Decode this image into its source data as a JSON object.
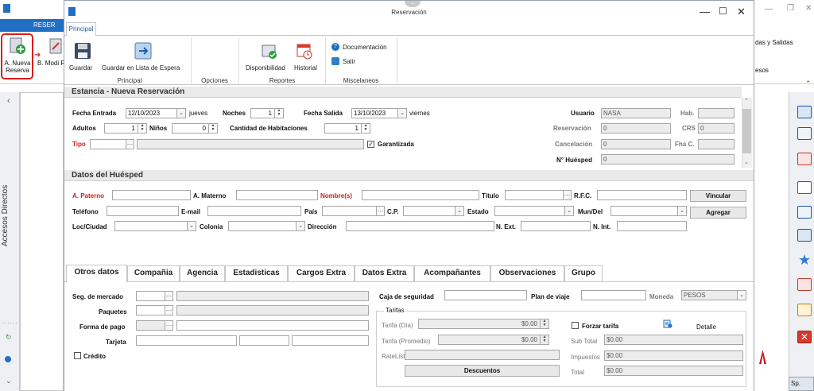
{
  "background_app": {
    "tab_label": "RESER",
    "new_reservation": "A. Nueva Reserva",
    "modify_reservation": "B. Modi Reser",
    "right_partial_1": "das y Salidas",
    "right_partial_2": "esos",
    "left_panel_label": "Accesos Directos",
    "right_bottom_label": "Sp."
  },
  "window": {
    "title": "Reservación",
    "tab": "Principal"
  },
  "ribbon": {
    "guardar": "Guardar",
    "guardar_lista": "Guardar en Lista de Espera",
    "grupo_principal": "Principal",
    "grupo_opciones": "Opciones",
    "disponibilidad": "Disponibilidad",
    "historial": "Historial",
    "grupo_reportes": "Reportes",
    "documentacion": "Documentación",
    "salir": "Salir",
    "grupo_miscelaneos": "Miscelaneos"
  },
  "estancia": {
    "title": "Estancia - Nueva Reservación",
    "fecha_entrada_label": "Fecha Entrada",
    "fecha_entrada": "12/10/2023",
    "fecha_entrada_dia": "jueves",
    "noches_label": "Noches",
    "noches": "1",
    "fecha_salida_label": "Fecha Salida",
    "fecha_salida": "13/10/2023",
    "fecha_salida_dia": "viernes",
    "adultos_label": "Adultos",
    "adultos": "1",
    "ninos_label": "Niños",
    "ninos": "0",
    "cant_hab_label": "Cantidad de Habitaciones",
    "cant_hab": "1",
    "tipo_label": "Tipo",
    "garantizada_label": "Garantizada",
    "usuario_label": "Usuario",
    "usuario": "NASA",
    "hab_label": "Hab.",
    "reservacion_label": "Reservación",
    "reservacion": "0",
    "crs_label": "CRS",
    "crs": "0",
    "cancelacion_label": "Cancelación",
    "cancelacion": "0",
    "fha_label": "Fha C.",
    "no_huesped_label": "N° Huésped",
    "no_huesped": "0"
  },
  "huesped": {
    "title": "Datos del Huésped",
    "a_paterno": "A. Paterno",
    "a_materno": "A. Materno",
    "nombre": "Nombre(s)",
    "titulo": "Título",
    "rfc": "R.F.C.",
    "vincular": "Vincular",
    "telefono": "Teléfono",
    "email": "E-mail",
    "pais": "País",
    "cp": "C.P.",
    "estado": "Estado",
    "mundel": "Mun/Del",
    "agregar": "Agregar",
    "loc_ciudad": "Loc/Ciudad",
    "colonia": "Colonia",
    "direccion": "Dirección",
    "n_ext": "N. Ext.",
    "n_int": "N. Int."
  },
  "tabs": [
    "Otros datos",
    "Compañia",
    "Agencia",
    "Estadisticas",
    "Cargos Extra",
    "Datos Extra",
    "Acompañantes",
    "Observaciones",
    "Grupo"
  ],
  "otros": {
    "seg_mercado": "Seg. de mercado",
    "paquetes": "Paquetes",
    "forma_pago": "Forma de pago",
    "tarjeta": "Tarjeta",
    "credito": "Crédito",
    "caja_seguridad": "Caja de seguridad",
    "plan_viaje": "Plan de viaje",
    "moneda_label": "Moneda",
    "moneda": "PESOS",
    "tarifas_title": "Tarifas",
    "tarifa_dia": "Tarifa (Día)",
    "tarifa_dia_val": "$0.00",
    "tarifa_prom": "Tarifa (Promedio)",
    "tarifa_prom_val": "$0.00",
    "ratelist": "RateList",
    "descuentos": "Descuentos",
    "forzar_tarifa": "Forzar tarifa",
    "detalle": "Detalle",
    "subtotal_label": "Sub Total",
    "subtotal": "$0.00",
    "impuestos_label": "Impuestos",
    "impuestos": "$0.00",
    "total_label": "Total",
    "total": "$0.00"
  },
  "colors": {
    "accent": "#1f6fc5",
    "required": "#d21b1b",
    "highlight_ring": "#d81e1e"
  }
}
